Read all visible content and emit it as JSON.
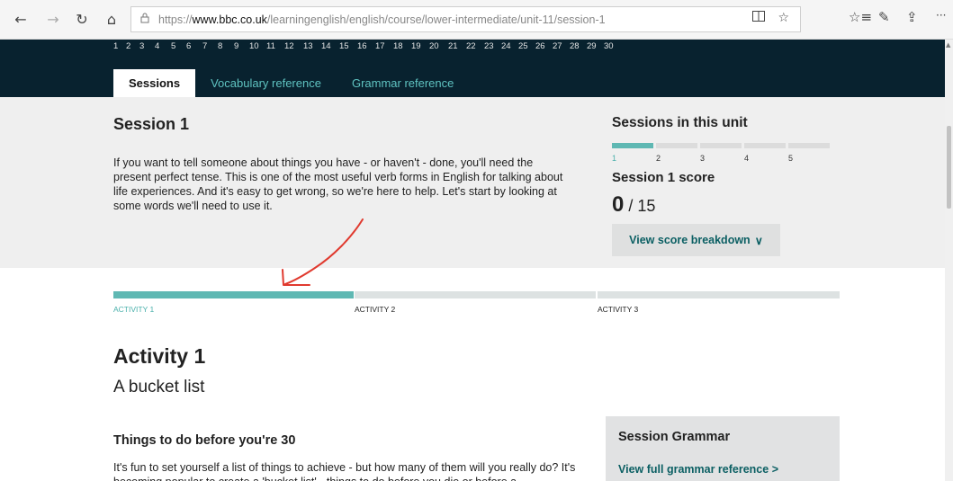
{
  "browser": {
    "back_icon": "←",
    "forward_icon": "→",
    "refresh_icon": "↻",
    "home_icon": "⌂",
    "lock_icon": "🔒",
    "url_prefix": "https://",
    "url_host": "www.bbc.co.uk",
    "url_path": "/learningenglish/english/course/lower-intermediate/unit-11/session-1",
    "reading_view_icon": "▯▯",
    "favorite_icon": "☆",
    "favorites_bar_icon": "☆≡",
    "notes_icon": "✎",
    "share_icon": "⇪",
    "more_icon": "···"
  },
  "units": [
    "1",
    "2",
    "3",
    "4",
    "5",
    "6",
    "7",
    "8",
    "9",
    "10",
    "11",
    "12",
    "13",
    "14",
    "15",
    "16",
    "17",
    "18",
    "19",
    "20",
    "21",
    "22",
    "23",
    "24",
    "25",
    "26",
    "27",
    "28",
    "29",
    "30"
  ],
  "tabs": [
    {
      "label": "Sessions",
      "active": true
    },
    {
      "label": "Vocabulary reference",
      "active": false
    },
    {
      "label": "Grammar reference",
      "active": false
    }
  ],
  "session": {
    "title": "Session 1",
    "description": "If you want to tell someone about things you have - or haven't - done, you'll need the present perfect tense. This is one of the most useful verb forms in English for talking about life experiences. And it's easy to get wrong, so we're here to help. Let's start by looking at some words we'll need to use it."
  },
  "sessions_unit": {
    "title": "Sessions in this unit",
    "labels": [
      "1",
      "2",
      "3",
      "4",
      "5"
    ],
    "current": 1,
    "score_title": "Session 1 score",
    "score_value": "0",
    "score_total": "/ 15",
    "breakdown_label": "View score breakdown",
    "breakdown_icon": "∨"
  },
  "activities": {
    "labels": [
      "ACTIVITY 1",
      "ACTIVITY 2",
      "ACTIVITY 3"
    ],
    "current": 1,
    "colors": {
      "done": "#5fb8b3",
      "todo": "#dde2e2"
    }
  },
  "activity": {
    "title": "Activity 1",
    "subtitle": "A bucket list",
    "section_title": "Things to do before you're 30",
    "body": "It's fun to set yourself a list of things to achieve - but how many of them will you really do? It's becoming popular to create a 'bucket list' - things to do before you die or before a"
  },
  "grammar": {
    "title": "Session Grammar",
    "link": "View full grammar reference",
    "link_icon": ">"
  },
  "annotation": {
    "color": "#e03a2f"
  }
}
